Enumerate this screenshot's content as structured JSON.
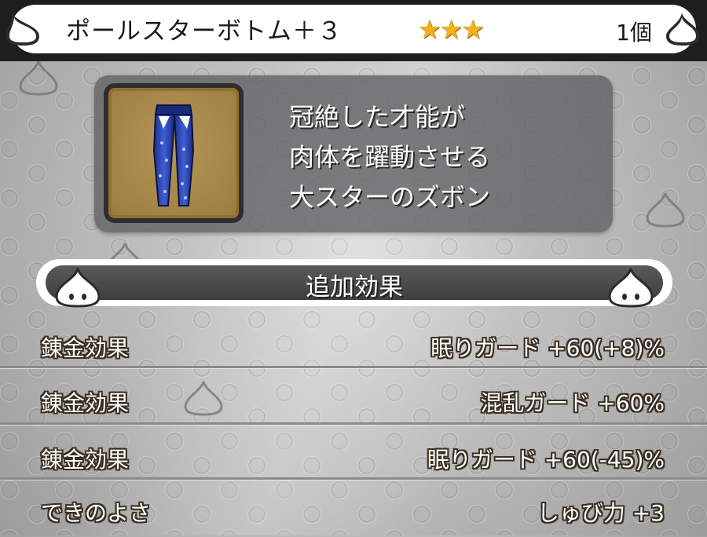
{
  "header": {
    "item_name": "ポールスターボトム＋３",
    "rarity_stars": 3,
    "count": "1個",
    "slime_icon": "slime-icon"
  },
  "item": {
    "icon": "pants-icon",
    "description_lines": [
      "冠絶した才能が",
      "肉体を躍動させる",
      "大スターのズボン"
    ]
  },
  "effects": {
    "title": "追加効果",
    "rows": [
      {
        "label": "錬金効果",
        "value": "眠りガード +60(+8)%"
      },
      {
        "label": "錬金効果",
        "value": "混乱ガード +60%"
      },
      {
        "label": "錬金効果",
        "value": "眠りガード +60(-45)%"
      },
      {
        "label": "できのよさ",
        "value": "しゅび力 +3"
      }
    ]
  },
  "colors": {
    "header_bg": "#1e1e1e",
    "star": "#f2b01b",
    "icon_bg": "#b59656",
    "text_outline": "#3a2f22"
  }
}
